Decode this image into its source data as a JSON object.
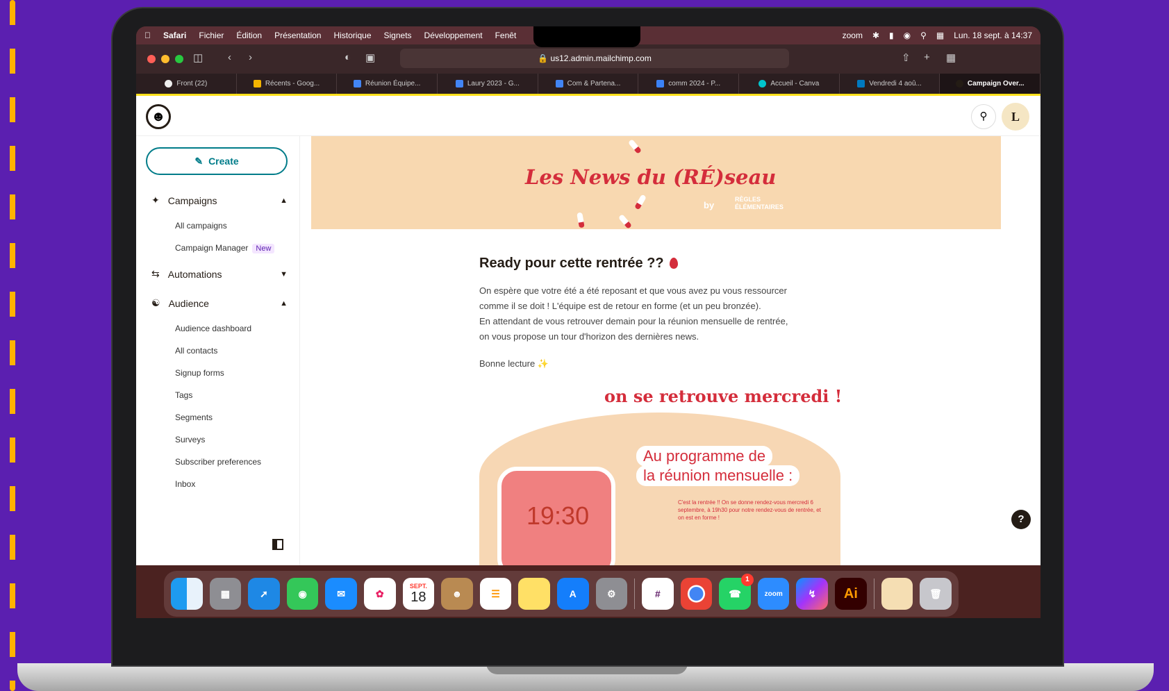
{
  "menubar": {
    "app": "Safari",
    "items": [
      "Fichier",
      "Édition",
      "Présentation",
      "Historique",
      "Signets",
      "Développement",
      "Fenêt"
    ],
    "status_app": "zoom",
    "datetime": "Lun. 18 sept. à 14:37"
  },
  "browser": {
    "url": "us12.admin.mailchimp.com",
    "tabs": [
      {
        "label": "Front (22)",
        "color": "#222222"
      },
      {
        "label": "Récents - Goog...",
        "color": "#f4b400"
      },
      {
        "label": "Réunion Équipe...",
        "color": "#4285f4"
      },
      {
        "label": "Laury 2023 - G...",
        "color": "#4285f4"
      },
      {
        "label": "Com & Partena...",
        "color": "#4285f4"
      },
      {
        "label": "comm 2024 - P...",
        "color": "#3b82f6"
      },
      {
        "label": "Accueil - Canva",
        "color": "#00c4cc"
      },
      {
        "label": "Vendredi 4 aoû...",
        "color": "#0079bf"
      },
      {
        "label": "Campaign Over...",
        "color": "#241c15"
      }
    ]
  },
  "app": {
    "avatar_initial": "L",
    "create_label": "Create",
    "campaigns": {
      "label": "Campaigns",
      "items": [
        "All campaigns",
        "Campaign Manager"
      ],
      "new_badge": "New"
    },
    "automations": {
      "label": "Automations"
    },
    "audience": {
      "label": "Audience",
      "items": [
        "Audience dashboard",
        "All contacts",
        "Signup forms",
        "Tags",
        "Segments",
        "Surveys",
        "Subscriber preferences",
        "Inbox"
      ]
    },
    "help": "?"
  },
  "email": {
    "banner_title": "Les News du (RÉ)seau",
    "banner_by": "by",
    "banner_brand": "RÈGLES ÉLÉMENTAIRES",
    "heading": "Ready pour cette rentrée ??",
    "paragraph_lines": [
      "On espère que votre été a été reposant et que vous avez pu vous ressourcer",
      "comme il se doit ! L'équipe est de retour en forme (et un peu bronzée).",
      "En attendant de vous retrouver demain pour la réunion mensuelle de rentrée,",
      "on vous propose un tour d'horizon des dernières news."
    ],
    "sign_off": "Bonne lecture",
    "promo_title": "on se retrouve mercredi !",
    "program_line1": "Au programme de",
    "program_line2": "la réunion mensuelle :",
    "promo_small": "C'est la rentrée !! On se donne rendez-vous mercredi 6 septembre, à 19h30 pour notre rendez-vous de rentrée, et on est en forme !",
    "phone_time": "19:30"
  },
  "dock": {
    "calendar_month": "SEPT.",
    "calendar_day": "18",
    "zoom_label": "zoom",
    "ai_label": "Ai",
    "whatsapp_badge": "1"
  }
}
